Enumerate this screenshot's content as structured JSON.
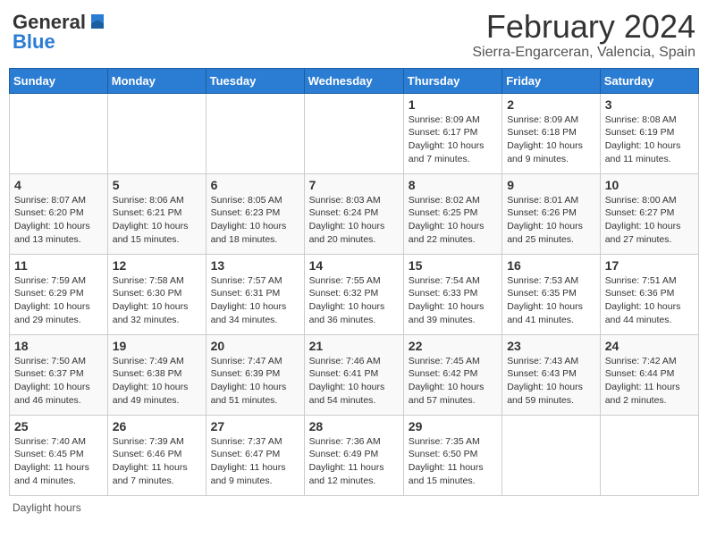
{
  "header": {
    "logo_general": "General",
    "logo_blue": "Blue",
    "title": "February 2024",
    "subtitle": "Sierra-Engarceran, Valencia, Spain"
  },
  "days_of_week": [
    "Sunday",
    "Monday",
    "Tuesday",
    "Wednesday",
    "Thursday",
    "Friday",
    "Saturday"
  ],
  "weeks": [
    [
      {
        "day": "",
        "info": ""
      },
      {
        "day": "",
        "info": ""
      },
      {
        "day": "",
        "info": ""
      },
      {
        "day": "",
        "info": ""
      },
      {
        "day": "1",
        "info": "Sunrise: 8:09 AM\nSunset: 6:17 PM\nDaylight: 10 hours\nand 7 minutes."
      },
      {
        "day": "2",
        "info": "Sunrise: 8:09 AM\nSunset: 6:18 PM\nDaylight: 10 hours\nand 9 minutes."
      },
      {
        "day": "3",
        "info": "Sunrise: 8:08 AM\nSunset: 6:19 PM\nDaylight: 10 hours\nand 11 minutes."
      }
    ],
    [
      {
        "day": "4",
        "info": "Sunrise: 8:07 AM\nSunset: 6:20 PM\nDaylight: 10 hours\nand 13 minutes."
      },
      {
        "day": "5",
        "info": "Sunrise: 8:06 AM\nSunset: 6:21 PM\nDaylight: 10 hours\nand 15 minutes."
      },
      {
        "day": "6",
        "info": "Sunrise: 8:05 AM\nSunset: 6:23 PM\nDaylight: 10 hours\nand 18 minutes."
      },
      {
        "day": "7",
        "info": "Sunrise: 8:03 AM\nSunset: 6:24 PM\nDaylight: 10 hours\nand 20 minutes."
      },
      {
        "day": "8",
        "info": "Sunrise: 8:02 AM\nSunset: 6:25 PM\nDaylight: 10 hours\nand 22 minutes."
      },
      {
        "day": "9",
        "info": "Sunrise: 8:01 AM\nSunset: 6:26 PM\nDaylight: 10 hours\nand 25 minutes."
      },
      {
        "day": "10",
        "info": "Sunrise: 8:00 AM\nSunset: 6:27 PM\nDaylight: 10 hours\nand 27 minutes."
      }
    ],
    [
      {
        "day": "11",
        "info": "Sunrise: 7:59 AM\nSunset: 6:29 PM\nDaylight: 10 hours\nand 29 minutes."
      },
      {
        "day": "12",
        "info": "Sunrise: 7:58 AM\nSunset: 6:30 PM\nDaylight: 10 hours\nand 32 minutes."
      },
      {
        "day": "13",
        "info": "Sunrise: 7:57 AM\nSunset: 6:31 PM\nDaylight: 10 hours\nand 34 minutes."
      },
      {
        "day": "14",
        "info": "Sunrise: 7:55 AM\nSunset: 6:32 PM\nDaylight: 10 hours\nand 36 minutes."
      },
      {
        "day": "15",
        "info": "Sunrise: 7:54 AM\nSunset: 6:33 PM\nDaylight: 10 hours\nand 39 minutes."
      },
      {
        "day": "16",
        "info": "Sunrise: 7:53 AM\nSunset: 6:35 PM\nDaylight: 10 hours\nand 41 minutes."
      },
      {
        "day": "17",
        "info": "Sunrise: 7:51 AM\nSunset: 6:36 PM\nDaylight: 10 hours\nand 44 minutes."
      }
    ],
    [
      {
        "day": "18",
        "info": "Sunrise: 7:50 AM\nSunset: 6:37 PM\nDaylight: 10 hours\nand 46 minutes."
      },
      {
        "day": "19",
        "info": "Sunrise: 7:49 AM\nSunset: 6:38 PM\nDaylight: 10 hours\nand 49 minutes."
      },
      {
        "day": "20",
        "info": "Sunrise: 7:47 AM\nSunset: 6:39 PM\nDaylight: 10 hours\nand 51 minutes."
      },
      {
        "day": "21",
        "info": "Sunrise: 7:46 AM\nSunset: 6:41 PM\nDaylight: 10 hours\nand 54 minutes."
      },
      {
        "day": "22",
        "info": "Sunrise: 7:45 AM\nSunset: 6:42 PM\nDaylight: 10 hours\nand 57 minutes."
      },
      {
        "day": "23",
        "info": "Sunrise: 7:43 AM\nSunset: 6:43 PM\nDaylight: 10 hours\nand 59 minutes."
      },
      {
        "day": "24",
        "info": "Sunrise: 7:42 AM\nSunset: 6:44 PM\nDaylight: 11 hours\nand 2 minutes."
      }
    ],
    [
      {
        "day": "25",
        "info": "Sunrise: 7:40 AM\nSunset: 6:45 PM\nDaylight: 11 hours\nand 4 minutes."
      },
      {
        "day": "26",
        "info": "Sunrise: 7:39 AM\nSunset: 6:46 PM\nDaylight: 11 hours\nand 7 minutes."
      },
      {
        "day": "27",
        "info": "Sunrise: 7:37 AM\nSunset: 6:47 PM\nDaylight: 11 hours\nand 9 minutes."
      },
      {
        "day": "28",
        "info": "Sunrise: 7:36 AM\nSunset: 6:49 PM\nDaylight: 11 hours\nand 12 minutes."
      },
      {
        "day": "29",
        "info": "Sunrise: 7:35 AM\nSunset: 6:50 PM\nDaylight: 11 hours\nand 15 minutes."
      },
      {
        "day": "",
        "info": ""
      },
      {
        "day": "",
        "info": ""
      }
    ]
  ],
  "footer": {
    "note": "Daylight hours"
  }
}
